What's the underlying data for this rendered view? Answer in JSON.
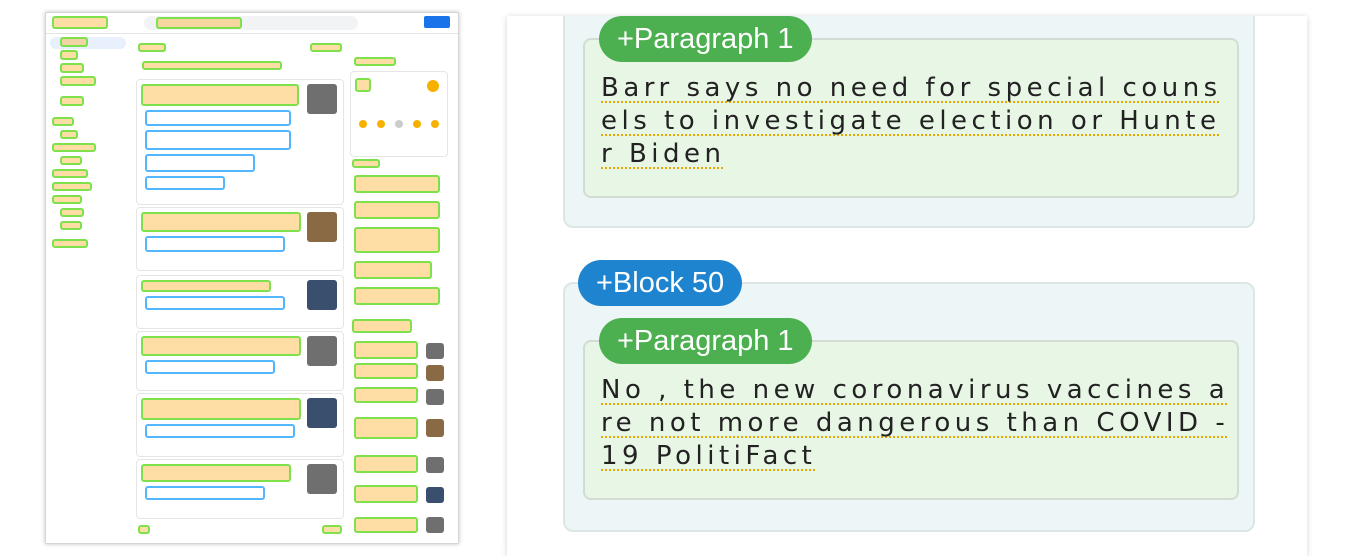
{
  "right_panel": {
    "block_label": "+Block 50",
    "paragraph_label": "+Paragraph 1",
    "paragraphs": [
      "Barr says no need for special counsels to investigate election or Hunter Biden",
      "No , the new coronavirus vaccines are not more dangerous than COVID - 19 PolitiFact"
    ]
  },
  "icons": {
    "thumbnail": "news-page-thumbnail",
    "image": "article-image-icon"
  },
  "colors": {
    "paragraph_tag": "#4caf50",
    "block_tag": "#1f84cf",
    "highlight_border": "#7ee04b",
    "highlight_fill": "#ffa000"
  }
}
